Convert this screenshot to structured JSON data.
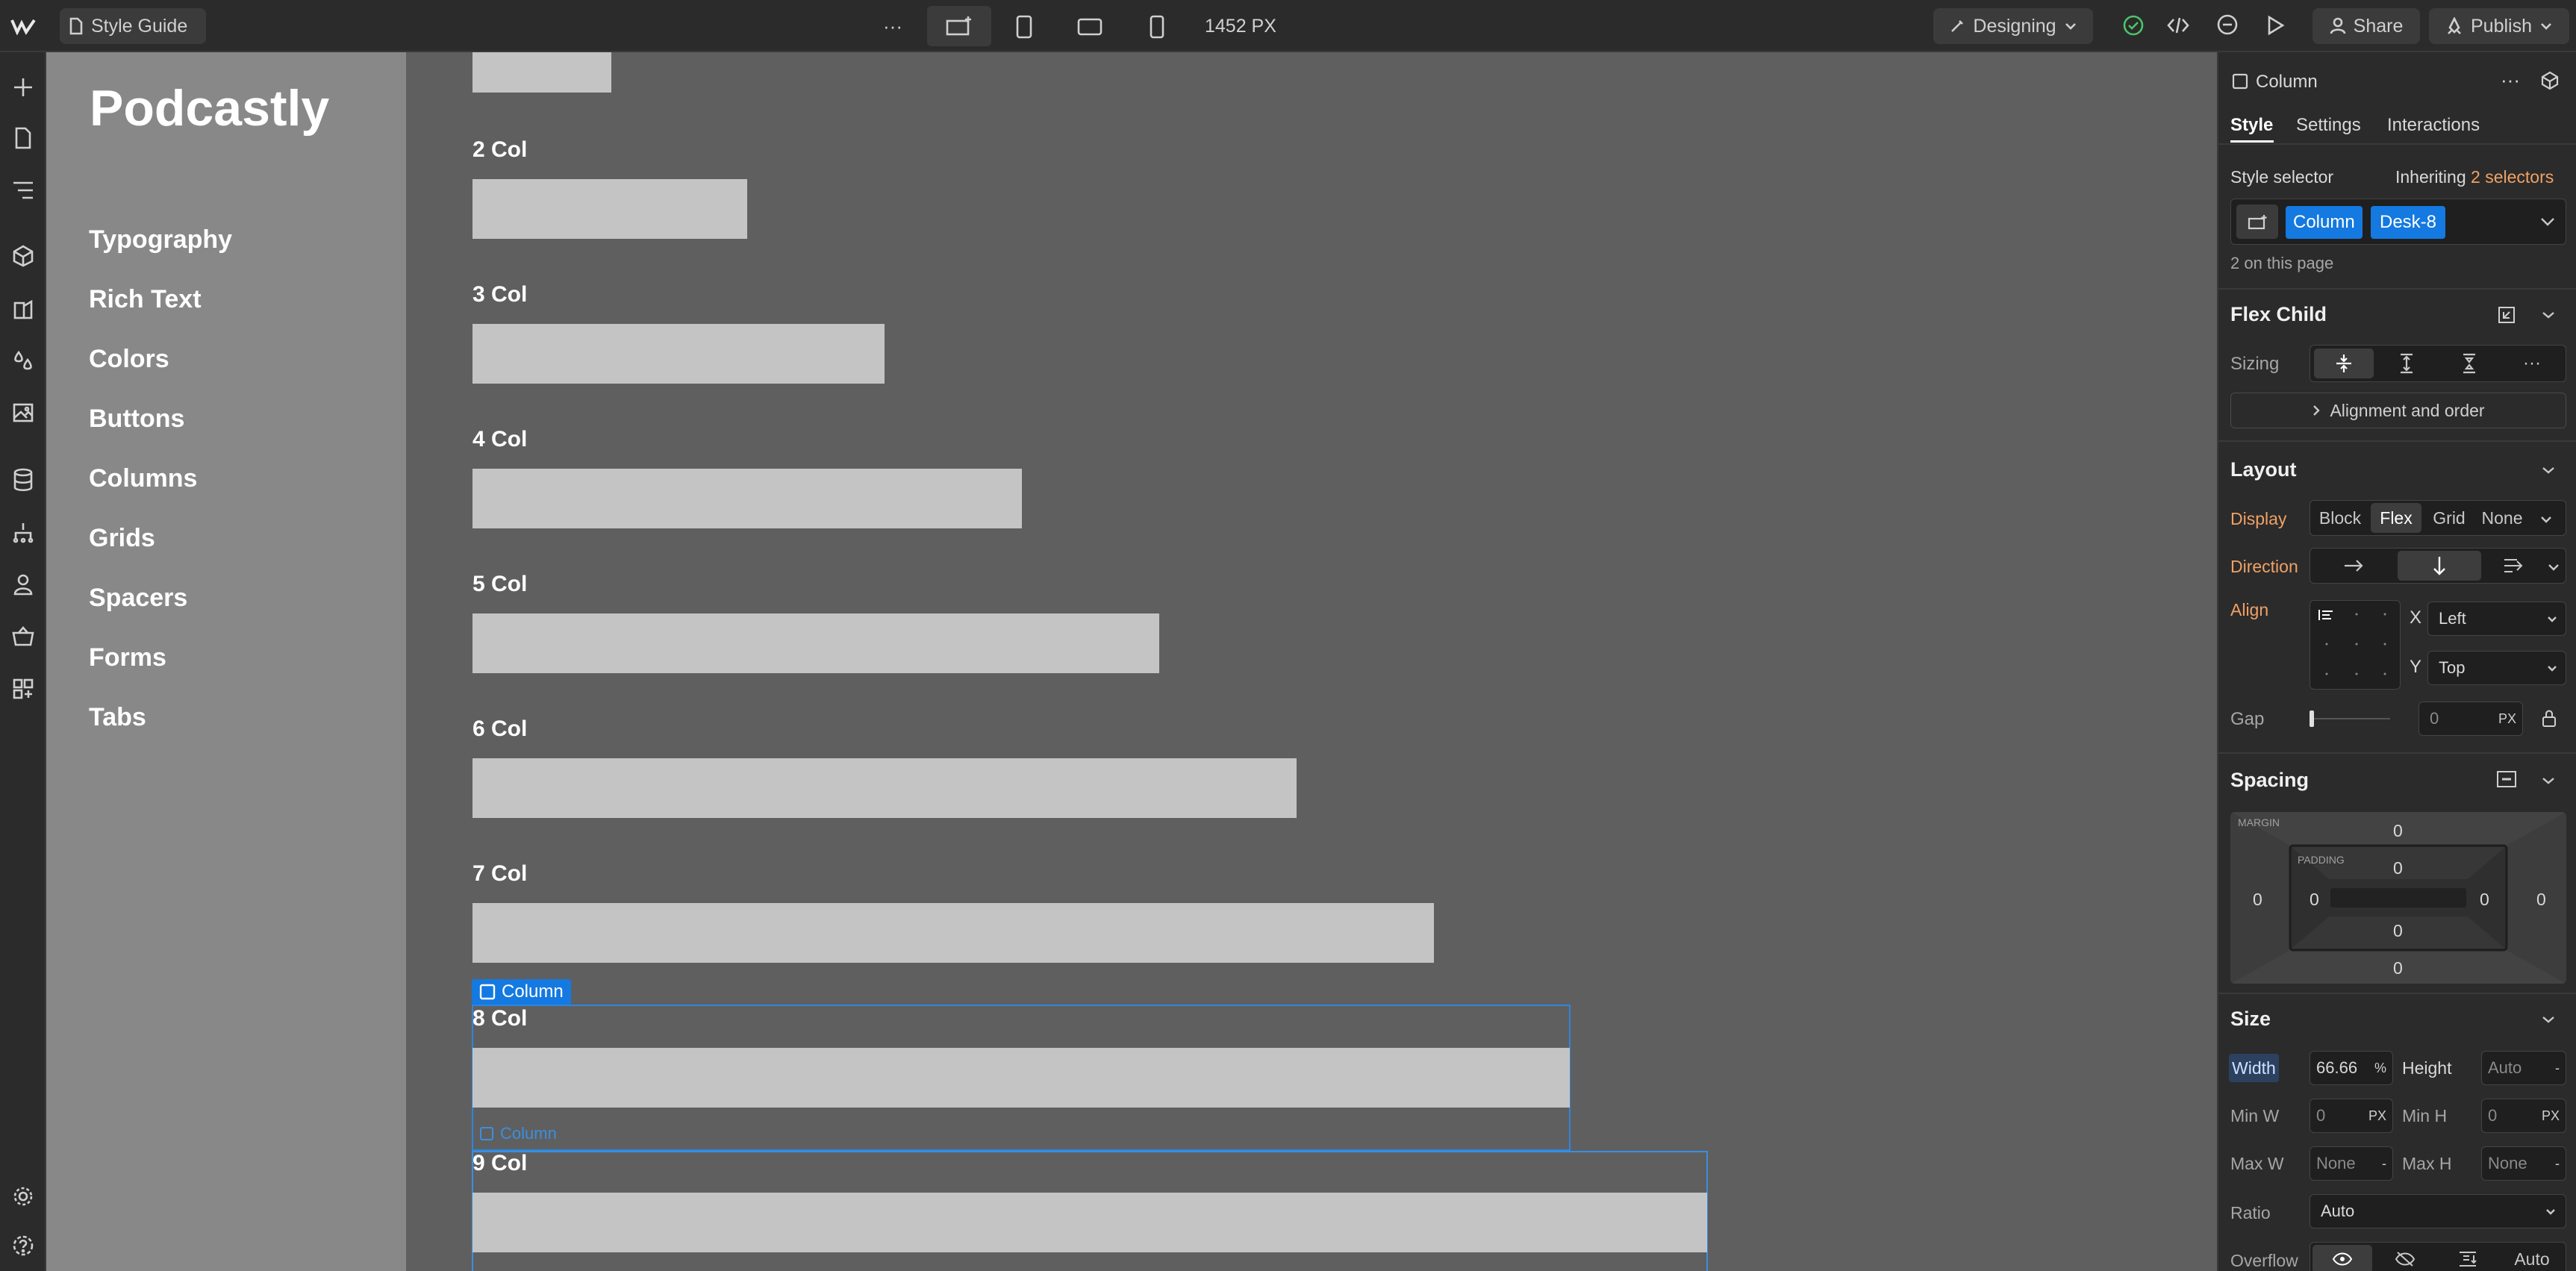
{
  "topbar": {
    "page_name": "Style Guide",
    "more": "···",
    "viewport_width": "1452 PX",
    "mode": "Designing",
    "share": "Share",
    "publish": "Publish"
  },
  "site": {
    "brand": "Podcastly",
    "nav": [
      "Typography",
      "Rich Text",
      "Colors",
      "Buttons",
      "Columns",
      "Grids",
      "Spacers",
      "Forms",
      "Tabs"
    ],
    "columns": [
      {
        "label": "2 Col"
      },
      {
        "label": "3 Col"
      },
      {
        "label": "4 Col"
      },
      {
        "label": "5 Col"
      },
      {
        "label": "6 Col"
      },
      {
        "label": "7 Col"
      },
      {
        "label": "8 Col"
      },
      {
        "label": "9 Col"
      }
    ],
    "selected_tag": "Column",
    "hover_tag": "Column"
  },
  "panel": {
    "element_name": "Column",
    "tabs": [
      "Style",
      "Settings",
      "Interactions"
    ],
    "active_tab": "Style",
    "style_selector_label": "Style selector",
    "inheriting_prefix": "Inheriting",
    "inheriting_link": "2 selectors",
    "selectors": [
      "Column",
      "Desk-8"
    ],
    "on_page": "2 on this page",
    "flex_child": {
      "title": "Flex Child",
      "sizing_label": "Sizing",
      "more": "···",
      "alignment_button": "Alignment and order"
    },
    "layout": {
      "title": "Layout",
      "display_label": "Display",
      "display_options": [
        "Block",
        "Flex",
        "Grid",
        "None"
      ],
      "display_active": "Flex",
      "direction_label": "Direction",
      "align_label": "Align",
      "x_label": "X",
      "x_value": "Left",
      "y_label": "Y",
      "y_value": "Top",
      "gap_label": "Gap",
      "gap_value": "0",
      "gap_unit": "PX"
    },
    "spacing": {
      "title": "Spacing",
      "margin_label": "MARGIN",
      "padding_label": "PADDING",
      "margin_top": "0",
      "margin_right": "0",
      "margin_bottom": "0",
      "margin_left": "0",
      "padding_top": "0",
      "padding_right": "0",
      "padding_bottom": "0",
      "padding_left": "0"
    },
    "size": {
      "title": "Size",
      "width_label": "Width",
      "width_value": "66.66",
      "width_unit": "%",
      "height_label": "Height",
      "height_value": "Auto",
      "height_unit": "-",
      "minw_label": "Min W",
      "minw_value": "0",
      "minw_unit": "PX",
      "minh_label": "Min H",
      "minh_value": "0",
      "minh_unit": "PX",
      "maxw_label": "Max W",
      "maxw_value": "None",
      "maxw_unit": "-",
      "maxh_label": "Max H",
      "maxh_value": "None",
      "maxh_unit": "-",
      "ratio_label": "Ratio",
      "ratio_value": "Auto",
      "overflow_label": "Overflow",
      "overflow_auto": "Auto"
    }
  },
  "colors": {
    "accent": "#1479e0",
    "warning_label": "#f0a165",
    "canvas": "#5f5f5f",
    "bar": "#c4c4c4"
  }
}
